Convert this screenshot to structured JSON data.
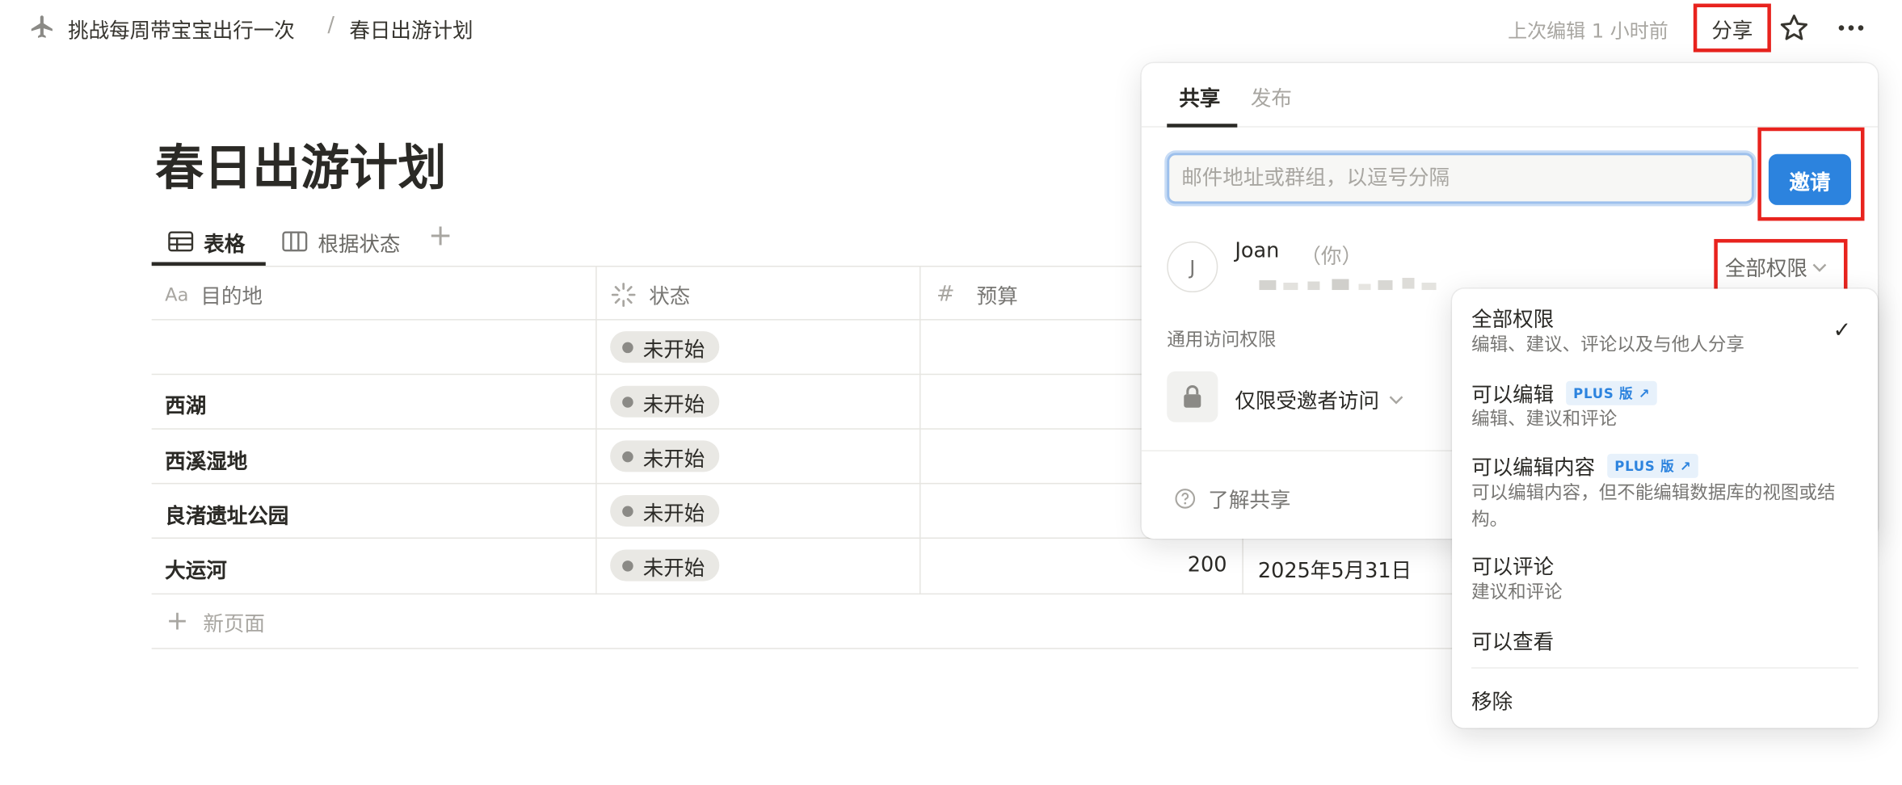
{
  "breadcrumb": {
    "parent": "挑战每周带宝宝出行一次",
    "separator": "/",
    "current": "春日出游计划"
  },
  "topbar": {
    "last_edited": "上次编辑 1 小时前",
    "share_label": "分享",
    "icons": [
      "airplane-icon",
      "star-icon",
      "more-icon"
    ]
  },
  "page": {
    "title": "春日出游计划",
    "views": [
      {
        "label": "表格",
        "icon": "table-icon",
        "active": true
      },
      {
        "label": "根据状态",
        "icon": "board-icon",
        "active": false
      }
    ]
  },
  "table": {
    "columns": [
      {
        "prefix": "Aa",
        "label": "目的地"
      },
      {
        "label": "状态",
        "icon": "status-icon"
      },
      {
        "prefix": "#",
        "label": "预算"
      }
    ],
    "rows": [
      {
        "title": "",
        "status": "未开始",
        "budget": "",
        "date": ""
      },
      {
        "title": "西湖",
        "status": "未开始",
        "budget": "",
        "date": ""
      },
      {
        "title": "西溪湿地",
        "status": "未开始",
        "budget": "",
        "date": ""
      },
      {
        "title": "良渚遗址公园",
        "status": "未开始",
        "budget": "",
        "date": ""
      },
      {
        "title": "大运河",
        "status": "未开始",
        "budget": "200",
        "date": "2025年5月31日"
      }
    ],
    "new_page": "新页面"
  },
  "share_panel": {
    "tabs": [
      "共享",
      "发布"
    ],
    "email_placeholder": "邮件地址或群组，以逗号分隔",
    "invite_label": "邀请",
    "user": {
      "initial": "J",
      "name": "Joan",
      "you": "（你）"
    },
    "permission": "全部权限",
    "general_access_label": "通用访问权限",
    "access_value": "仅限受邀者访问",
    "learn_more": "了解共享"
  },
  "permission_menu": {
    "options": [
      {
        "title": "全部权限",
        "desc": "编辑、建议、评论以及与他人分享",
        "checked": true
      },
      {
        "title": "可以编辑",
        "badge": "PLUS 版 ↗",
        "desc": "编辑、建议和评论"
      },
      {
        "title": "可以编辑内容",
        "badge": "PLUS 版 ↗",
        "desc": "可以编辑内容，但不能编辑数据库的视图或结构。"
      },
      {
        "title": "可以评论",
        "desc": "建议和评论"
      },
      {
        "title": "可以查看"
      }
    ],
    "remove_label": "移除"
  },
  "colors": {
    "highlight_frame": "#e8231e",
    "invite_blue": "#2c83de",
    "status_pill": "#e9e8e4"
  }
}
